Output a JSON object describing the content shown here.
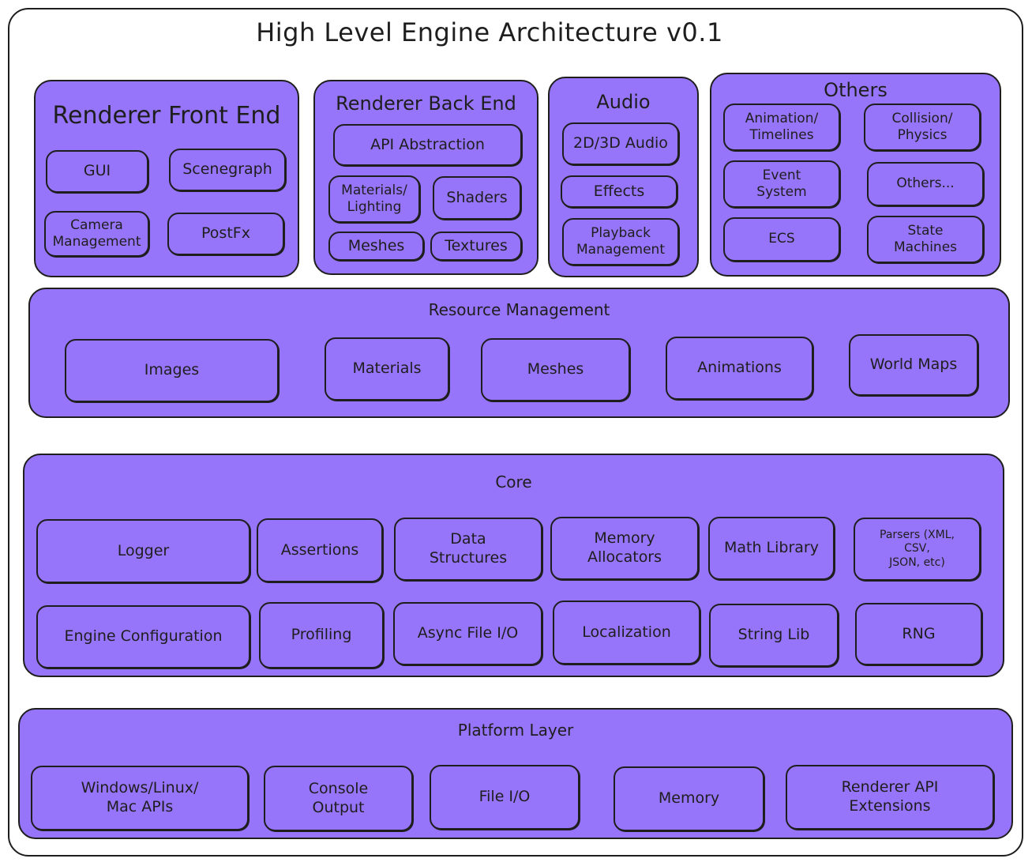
{
  "title": "High Level Engine Architecture v0.1",
  "colors": {
    "fill": "#9775fa",
    "stroke": "#1e1e1e",
    "background": "#ffffff"
  },
  "renderer_front_end": {
    "title": "Renderer Front End",
    "items": [
      "GUI",
      "Scenegraph",
      "Camera\nManagement",
      "PostFx"
    ]
  },
  "renderer_back_end": {
    "title": "Renderer Back End",
    "items": [
      "API Abstraction",
      "Materials/\nLighting",
      "Shaders",
      "Meshes",
      "Textures"
    ]
  },
  "audio": {
    "title": "Audio",
    "items": [
      "2D/3D Audio",
      "Effects",
      "Playback\nManagement"
    ]
  },
  "others": {
    "title": "Others",
    "items": [
      "Animation/\nTimelines",
      "Collision/\nPhysics",
      "Event\nSystem",
      "Others...",
      "ECS",
      "State\nMachines"
    ]
  },
  "resource_management": {
    "title": "Resource Management",
    "items": [
      "Images",
      "Materials",
      "Meshes",
      "Animations",
      "World Maps"
    ]
  },
  "core": {
    "title": "Core",
    "items": [
      "Logger",
      "Assertions",
      "Data\nStructures",
      "Memory\nAllocators",
      "Math Library",
      "Parsers (XML,\nCSV,\nJSON, etc)",
      "Engine Configuration",
      "Profiling",
      "Async File I/O",
      "Localization",
      "String Lib",
      "RNG"
    ]
  },
  "platform_layer": {
    "title": "Platform Layer",
    "items": [
      "Windows/Linux/\nMac APIs",
      "Console\nOutput",
      "File I/O",
      "Memory",
      "Renderer API\nExtensions"
    ]
  }
}
